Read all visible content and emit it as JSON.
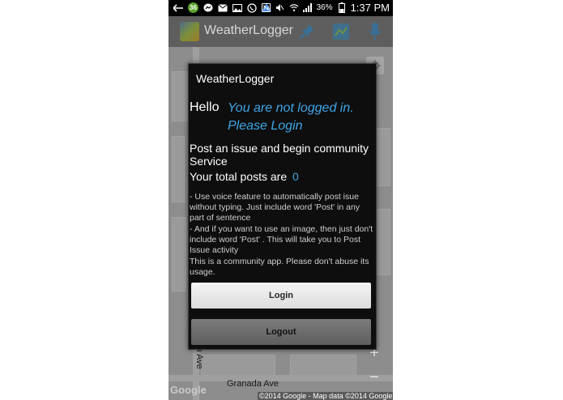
{
  "status_bar": {
    "notification_badge": "36",
    "battery_percent": "36%",
    "time": "1:37 PM"
  },
  "action_bar": {
    "title": "WeatherLogger"
  },
  "map": {
    "street_label": "Granada Ave",
    "vertical_street_fragment": "sta Ave",
    "google_logo": "Google",
    "copyright": "©2014 Google - Map data ©2014 Google",
    "zoom_in": "+",
    "zoom_out": "−"
  },
  "dialog": {
    "title": "WeatherLogger",
    "hello": "Hello",
    "status_message": "You are not logged in. Please Login",
    "post_issue_text": "Post an issue and begin community Service",
    "total_posts_label": "Your total posts are",
    "total_posts_count": "0",
    "info_voice": "- Use voice feature to automatically post isue without typing. Just include word 'Post' in any part of sentence",
    "info_image": "- And if you want to use an image, then just don't include word 'Post' . This will take you to Post Issue activity",
    "info_community": "This is a community app. Please don't abuse its usage.",
    "login_button": "Login",
    "logout_button": "Logout"
  },
  "colors": {
    "accent_blue": "#3ea6e6",
    "dialog_bg": "#0e0e0e"
  }
}
